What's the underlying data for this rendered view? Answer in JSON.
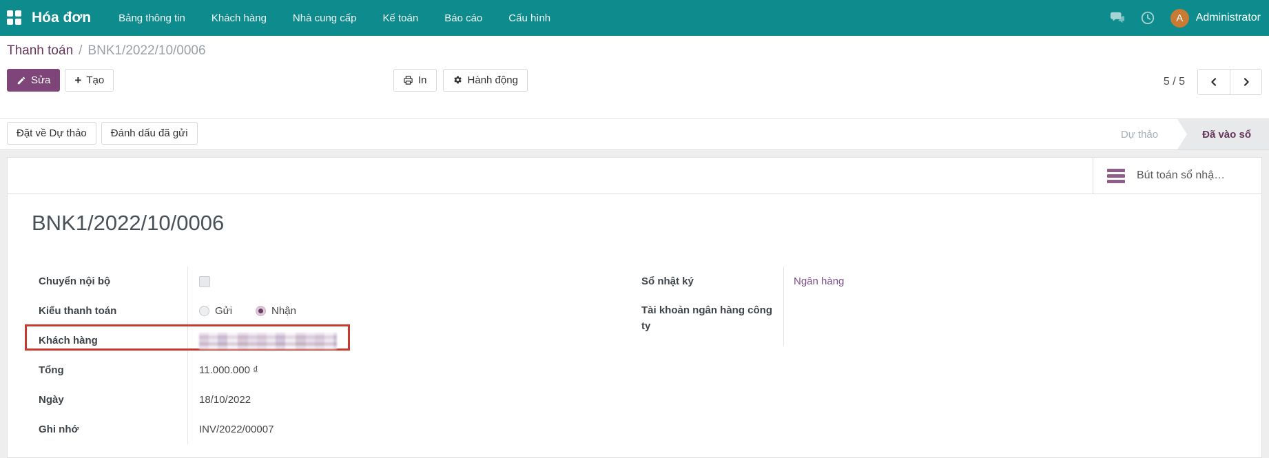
{
  "navbar": {
    "app_title": "Hóa đơn",
    "menu": [
      "Bảng thông tin",
      "Khách hàng",
      "Nhà cung cấp",
      "Kế toán",
      "Báo cáo",
      "Cấu hình"
    ],
    "user": {
      "name": "Administrator",
      "avatar_initial": "A"
    }
  },
  "breadcrumb": {
    "parent": "Thanh toán",
    "separator": "/",
    "current": "BNK1/2022/10/0006"
  },
  "control_panel": {
    "edit_label": "Sửa",
    "create_label": "Tạo",
    "create_icon": "+",
    "print_label": "In",
    "action_label": "Hành động",
    "pager_text": "5 / 5"
  },
  "statusbar": {
    "reset_draft_label": "Đặt về Dự thảo",
    "mark_sent_label": "Đánh dấu đã gửi",
    "stage_inactive": "Dự thảo",
    "stage_active": "Đã vào sổ"
  },
  "sheet": {
    "stat_button_label": "Bút toán sổ nhậ…",
    "title": "BNK1/2022/10/0006",
    "fields": {
      "internal_transfer": {
        "label": "Chuyển nội bộ",
        "checked": false
      },
      "payment_type": {
        "label": "Kiểu thanh toán",
        "options": [
          "Gửi",
          "Nhận"
        ],
        "selected": "Nhận"
      },
      "customer": {
        "label": "Khách hàng",
        "value": "",
        "redacted": true
      },
      "amount": {
        "label": "Tổng",
        "value": "11.000.000 ₫"
      },
      "date": {
        "label": "Ngày",
        "value": "18/10/2022"
      },
      "memo": {
        "label": "Ghi nhớ",
        "value": "INV/2022/00007"
      },
      "journal": {
        "label": "Sổ nhật ký",
        "value": "Ngân hàng"
      },
      "bank_account": {
        "label": "Tài khoản ngân hàng công ty",
        "value": ""
      }
    }
  },
  "colors": {
    "navbar_teal": "#0d8b8d",
    "primary_purple": "#7d4578",
    "link_purple": "#7b4d8a",
    "active_stage_text": "#65365c",
    "highlight_red": "#c53c2e",
    "avatar_orange": "#c97a33"
  }
}
